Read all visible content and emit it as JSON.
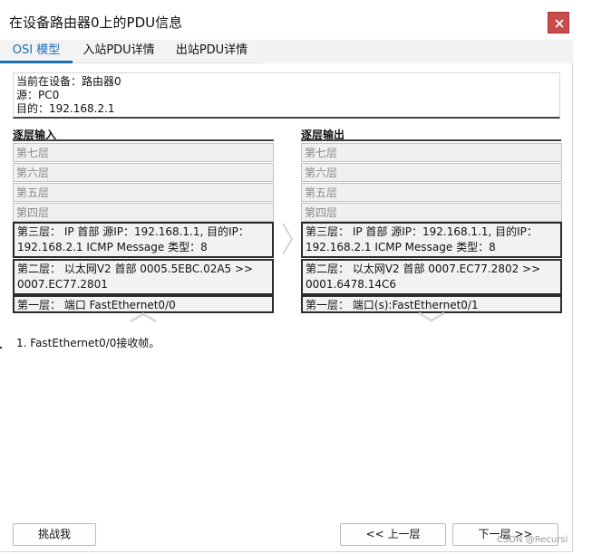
{
  "window": {
    "title": "在设备路由器0上的PDU信息"
  },
  "tabs": [
    {
      "label": "OSI 模型"
    },
    {
      "label": "入站PDU详情"
    },
    {
      "label": "出站PDU详情"
    }
  ],
  "info": {
    "device": "当前在设备：路由器0",
    "source": "源：PC0",
    "destination": "目的：192.168.2.1"
  },
  "layers_in": {
    "header": "逐层输入",
    "l7": "第七层",
    "l6": "第六层",
    "l5": "第五层",
    "l4": "第四层",
    "l3": "第三层： IP 首部 源IP：192.168.1.1, 目的IP：192.168.2.1 ICMP Message 类型：8",
    "l2": "第二层： 以太网V2 首部 0005.5EBC.02A5 >> 0007.EC77.2801",
    "l1": "第一层： 端口 FastEthernet0/0"
  },
  "layers_out": {
    "header": "逐层输出",
    "l7": "第七层",
    "l6": "第六层",
    "l5": "第五层",
    "l4": "第四层",
    "l3": "第三层： IP 首部 源IP：192.168.1.1, 目的IP：192.168.2.1 ICMP Message 类型：8",
    "l2": "第二层： 以太网V2 首部 0007.EC77.2802 >> 0001.6478.14C6",
    "l1": "第一层： 端口(s):FastEthernet0/1"
  },
  "description": "1. FastEthernet0/0接收帧。",
  "buttons": {
    "challenge": "挑战我",
    "prev": "<< 上一层",
    "next": "下一层 >>"
  },
  "watermark": "CSDN @Recursi",
  "icons": {
    "close": "close-icon",
    "mid_arrow": "chevron-right-icon",
    "in_arrow": "up-arrow-icon",
    "out_arrow": "down-arrow-icon"
  },
  "colors": {
    "accent": "#1c6fb4",
    "close_button": "#c94c4c"
  }
}
